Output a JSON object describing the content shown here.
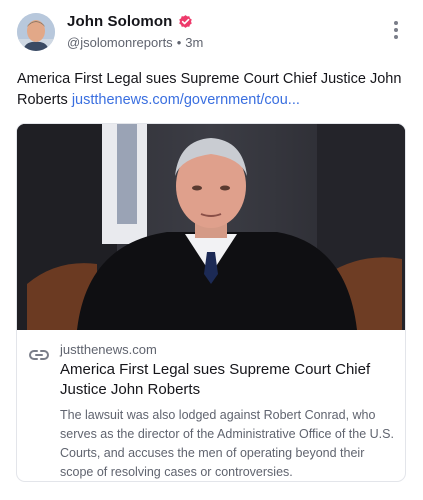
{
  "author": {
    "name": "John Solomon",
    "handle": "@jsolomonreports",
    "separator": "•",
    "time": "3m"
  },
  "post": {
    "text": "America First Legal sues Supreme Court Chief Justice John Roberts",
    "link": "justthenews.com/government/cou..."
  },
  "card": {
    "domain": "justthenews.com",
    "title": "America First Legal sues Supreme Court Chief Justice John Roberts",
    "description": "The lawsuit was also lodged against Robert Conrad, who serves as the director of the Administrative Office of the U.S. Courts, and accuses the men of operating beyond their scope of resolving cases or controversies."
  },
  "icons": {
    "verified": "verified-badge-icon",
    "more": "more-vertical-icon",
    "link": "link-icon"
  },
  "colors": {
    "verified_badge": "#ee3a6b",
    "link": "#3a6fe0",
    "meta_text": "#60646f"
  }
}
